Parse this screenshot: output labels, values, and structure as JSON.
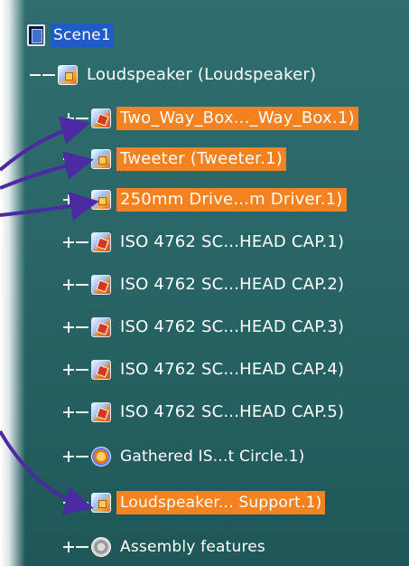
{
  "tree": {
    "root": {
      "label": "Scene1",
      "icon": "scene-icon"
    },
    "product": {
      "label": "Loudspeaker (Loudspeaker)",
      "icon": "assembly-icon"
    },
    "children": [
      {
        "label": "Two_Way_Box..._Way_Box.1)",
        "icon": "component-icon",
        "highlighted": true
      },
      {
        "label": "Tweeter (Tweeter.1)",
        "icon": "component-icon",
        "highlighted": true
      },
      {
        "label": "250mm Drive...m Driver.1)",
        "icon": "component-icon",
        "highlighted": true
      },
      {
        "label": "ISO 4762 SC...HEAD CAP.1)",
        "icon": "part-icon",
        "highlighted": false
      },
      {
        "label": "ISO 4762 SC...HEAD CAP.2)",
        "icon": "part-icon",
        "highlighted": false
      },
      {
        "label": "ISO 4762 SC...HEAD CAP.3)",
        "icon": "part-icon",
        "highlighted": false
      },
      {
        "label": "ISO 4762 SC...HEAD CAP.4)",
        "icon": "part-icon",
        "highlighted": false
      },
      {
        "label": "ISO 4762 SC...HEAD CAP.5)",
        "icon": "part-icon",
        "highlighted": false
      },
      {
        "label": "Gathered IS...t Circle.1)",
        "icon": "gear-icon",
        "highlighted": false
      },
      {
        "label": "Loudspeaker... Support.1)",
        "icon": "component-icon",
        "highlighted": true
      },
      {
        "label": "Assembly features",
        "icon": "features-icon",
        "highlighted": false
      }
    ]
  },
  "colors": {
    "highlight": "#f58220",
    "selection": "#1f5cc8",
    "background": "#2a6667",
    "arrow": "#4b2aa3"
  }
}
